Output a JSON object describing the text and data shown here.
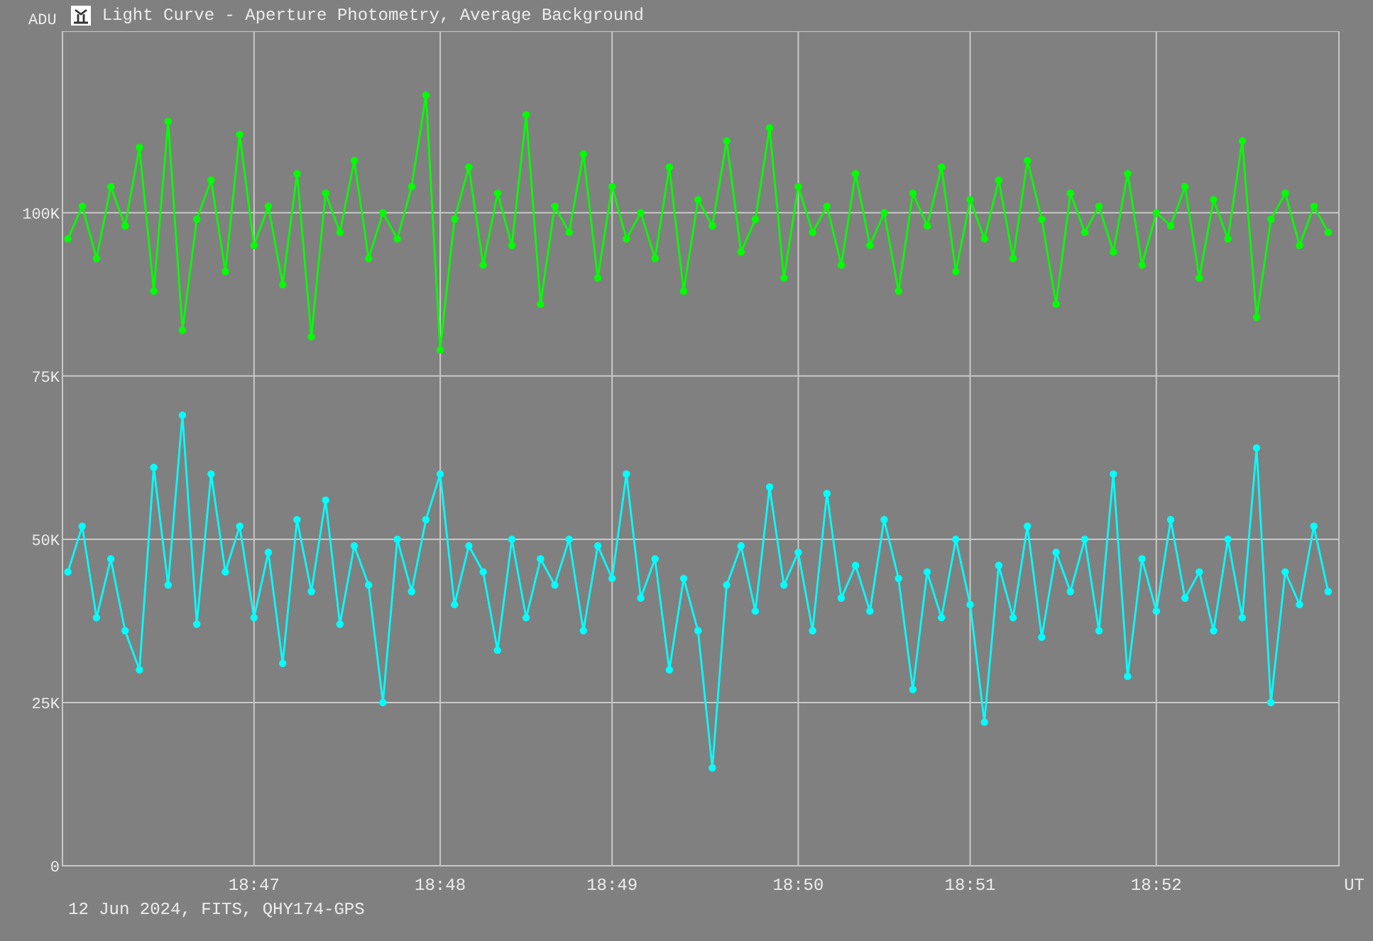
{
  "window": {
    "title": "Light Curve - Aperture Photometry, Average Background"
  },
  "chart_data": {
    "type": "line",
    "grid": true,
    "xlabel": "UT",
    "ylabel": "ADU",
    "ylim": [
      0,
      127800
    ],
    "yticks": [
      {
        "value": 0,
        "label": "0"
      },
      {
        "value": 25000,
        "label": "25K"
      },
      {
        "value": 50000,
        "label": "50K"
      },
      {
        "value": 75000,
        "label": "75K"
      },
      {
        "value": 100000,
        "label": "100K"
      }
    ],
    "categories": [
      null,
      null,
      null,
      null,
      null,
      null,
      null,
      null,
      null,
      null,
      null,
      null,
      null,
      "18:47",
      null,
      null,
      null,
      null,
      null,
      null,
      null,
      null,
      null,
      null,
      null,
      null,
      "18:48",
      null,
      null,
      null,
      null,
      null,
      null,
      null,
      null,
      null,
      null,
      null,
      "18:49",
      null,
      null,
      null,
      null,
      null,
      null,
      null,
      null,
      null,
      null,
      null,
      null,
      "18:50",
      null,
      null,
      null,
      null,
      null,
      null,
      null,
      null,
      null,
      null,
      null,
      "18:51",
      null,
      null,
      null,
      null,
      null,
      null,
      null,
      null,
      null,
      null,
      null,
      null,
      "18:52",
      null,
      null,
      null,
      null,
      null,
      null,
      null,
      null,
      null,
      null,
      null,
      null
    ],
    "series": [
      {
        "color": "#00ff00",
        "marker": "circle",
        "values": [
          96000,
          101000,
          93000,
          104000,
          98000,
          110000,
          88000,
          114000,
          82000,
          99000,
          105000,
          91000,
          112000,
          95000,
          101000,
          89000,
          106000,
          81000,
          103000,
          97000,
          108000,
          93000,
          100000,
          96000,
          104000,
          118000,
          79000,
          99000,
          107000,
          92000,
          103000,
          95000,
          115000,
          86000,
          101000,
          97000,
          109000,
          90000,
          104000,
          96000,
          100000,
          93000,
          107000,
          88000,
          102000,
          98000,
          111000,
          94000,
          99000,
          113000,
          90000,
          104000,
          97000,
          101000,
          92000,
          106000,
          95000,
          100000,
          88000,
          103000,
          98000,
          107000,
          91000,
          102000,
          96000,
          105000,
          93000,
          108000,
          99000,
          86000,
          103000,
          97000,
          101000,
          94000,
          106000,
          92000,
          100000,
          98000,
          104000,
          90000,
          102000,
          96000,
          111000,
          84000,
          99000,
          103000,
          95000,
          101000,
          97000
        ]
      },
      {
        "color": "#00ffff",
        "marker": "circle",
        "values": [
          45000,
          52000,
          38000,
          47000,
          36000,
          30000,
          61000,
          43000,
          69000,
          37000,
          60000,
          45000,
          52000,
          38000,
          48000,
          31000,
          53000,
          42000,
          56000,
          37000,
          49000,
          43000,
          25000,
          50000,
          42000,
          53000,
          60000,
          40000,
          49000,
          45000,
          33000,
          50000,
          38000,
          47000,
          43000,
          50000,
          36000,
          49000,
          44000,
          60000,
          41000,
          47000,
          30000,
          44000,
          36000,
          15000,
          43000,
          49000,
          39000,
          58000,
          43000,
          48000,
          36000,
          57000,
          41000,
          46000,
          39000,
          53000,
          44000,
          27000,
          45000,
          38000,
          50000,
          40000,
          22000,
          46000,
          38000,
          52000,
          35000,
          48000,
          42000,
          50000,
          36000,
          60000,
          29000,
          47000,
          39000,
          53000,
          41000,
          45000,
          36000,
          50000,
          38000,
          64000,
          25000,
          45000,
          40000,
          52000,
          42000
        ]
      }
    ]
  },
  "status_bar": {
    "text": "12 Jun 2024, FITS, QHY174-GPS"
  }
}
